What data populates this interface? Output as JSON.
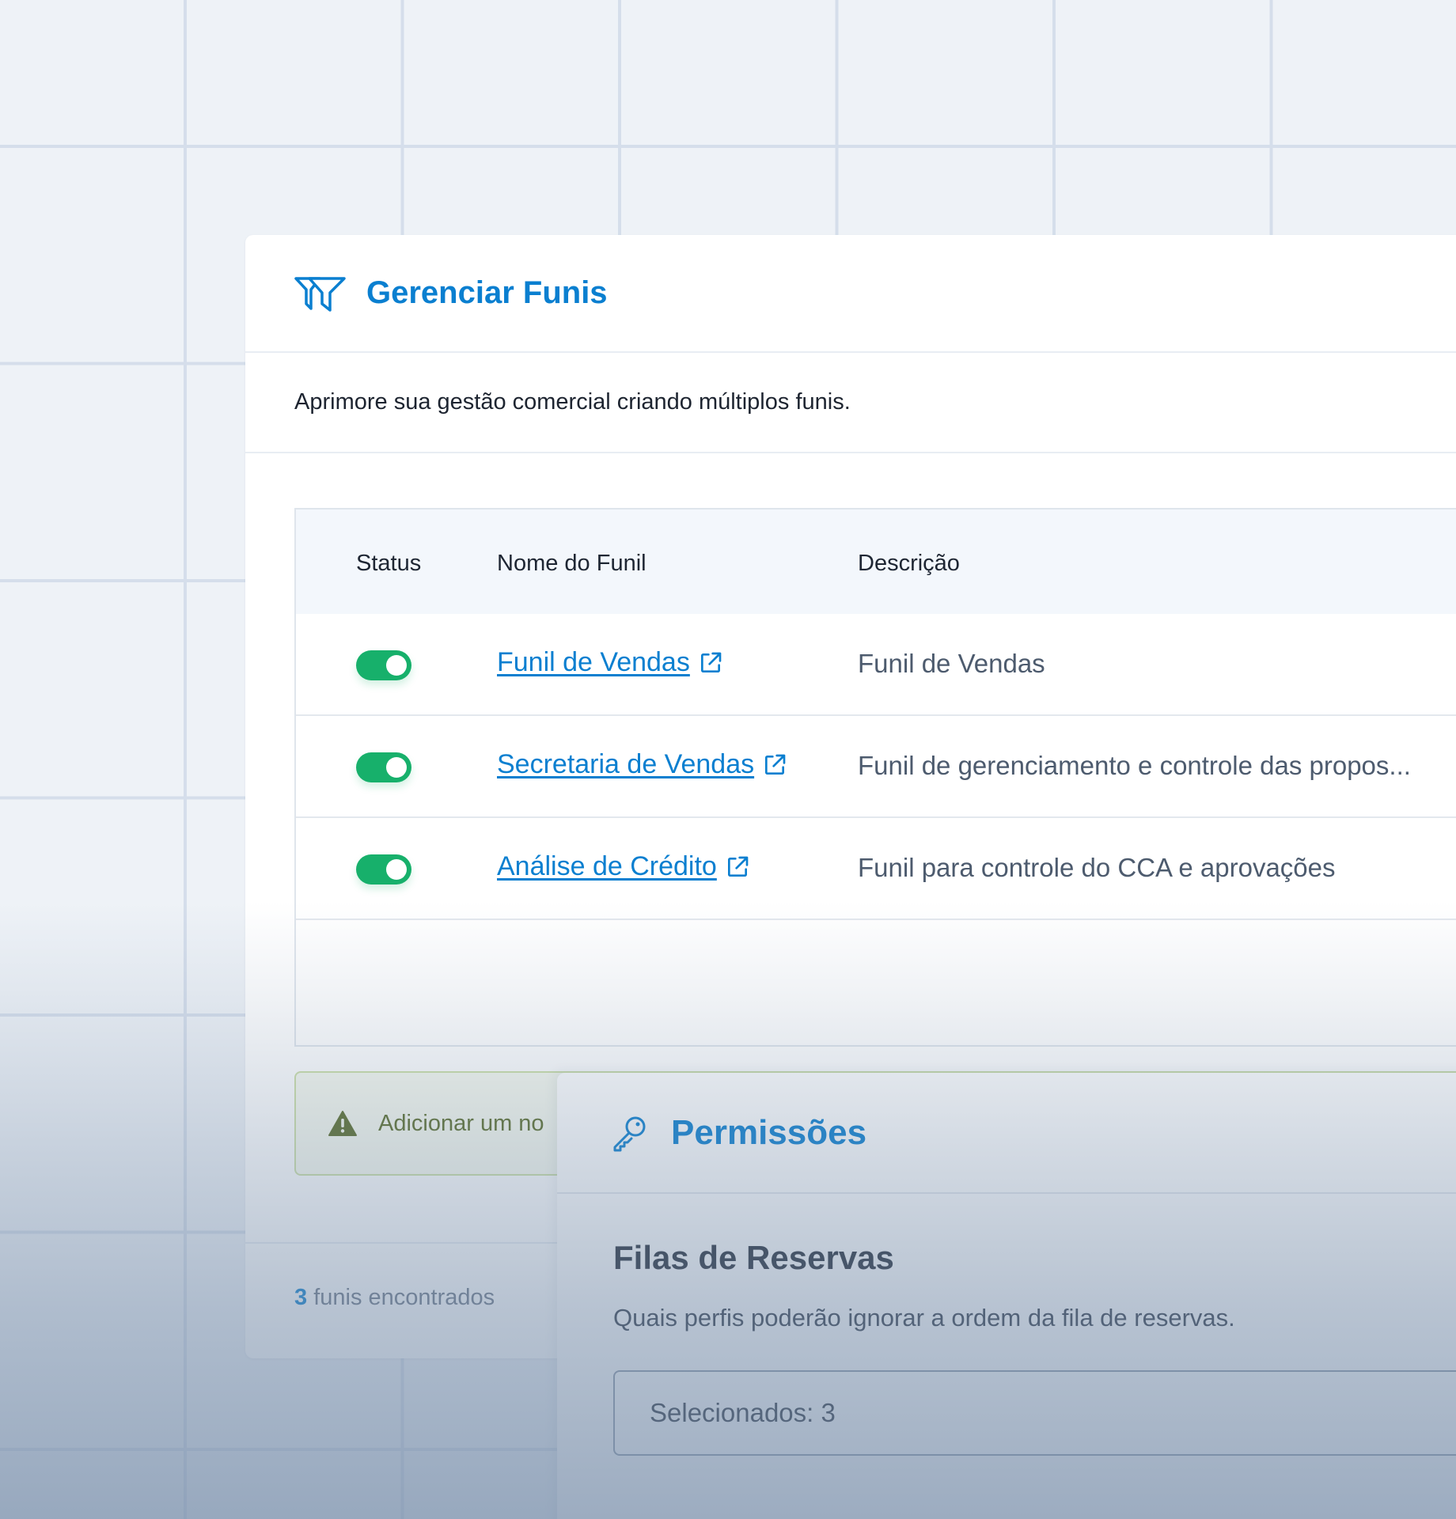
{
  "funnels_card": {
    "title": "Gerenciar Funis",
    "icon": "funnel-icon",
    "subtitle": "Aprimore sua gestão comercial criando múltiplos funis.",
    "columns": {
      "status": "Status",
      "name": "Nome do Funil",
      "description": "Descrição"
    },
    "rows": [
      {
        "active": true,
        "name": "Funil de Vendas",
        "description": "Funil de Vendas"
      },
      {
        "active": true,
        "name": "Secretaria de Vendas",
        "description": "Funil de gerenciamento e controle das propos..."
      },
      {
        "active": true,
        "name": "Análise de Crédito",
        "description": "Funil para controle do CCA e aprovações"
      }
    ],
    "warning": {
      "icon": "warning-icon",
      "text": "Adicionar um no"
    },
    "footer": {
      "count": "3",
      "count_label": " funis encontrados"
    }
  },
  "permissions_card": {
    "title": "Permissões",
    "icon": "key-icon",
    "section_title": "Filas de Reservas",
    "section_description": "Quais perfis poderão ignorar a ordem da fila de reservas.",
    "select_value": "Selecionados: 3"
  },
  "colors": {
    "accent": "#0a7fd0",
    "toggle_on": "#17b06b",
    "warning_text": "#5b6d2a"
  }
}
